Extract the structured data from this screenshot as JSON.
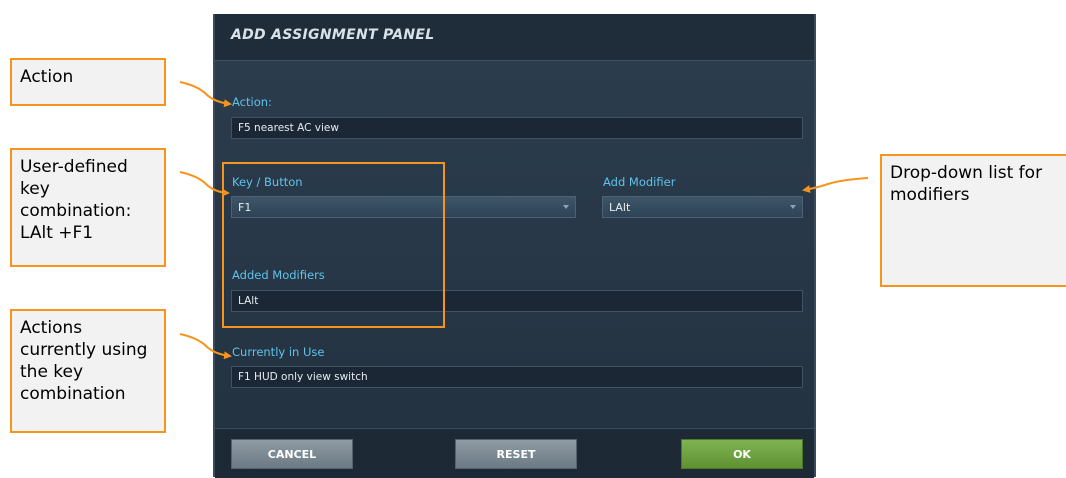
{
  "panel": {
    "title": "ADD ASSIGNMENT PANEL",
    "action": {
      "label": "Action:",
      "value": "F5 nearest AC view"
    },
    "key_button": {
      "label": "Key / Button",
      "value": "F1"
    },
    "add_modifier": {
      "label": "Add Modifier",
      "value": "LAlt"
    },
    "added_modifiers": {
      "label": "Added Modifiers",
      "value": "LAlt"
    },
    "currently_in_use": {
      "label": "Currently in Use",
      "value": "F1 HUD only view switch"
    },
    "buttons": {
      "cancel": "CANCEL",
      "reset": "RESET",
      "ok": "OK"
    }
  },
  "callouts": {
    "action": "Action",
    "key_combination": "User-defined key combination: LAlt +F1",
    "in_use": "Actions currently using the key combination",
    "dropdown": "Drop-down list for modifiers"
  },
  "colors": {
    "accent": "#f7941d",
    "label": "#5ec4ea",
    "ok_button": "#6fa344",
    "panel_bg": "#273747"
  }
}
